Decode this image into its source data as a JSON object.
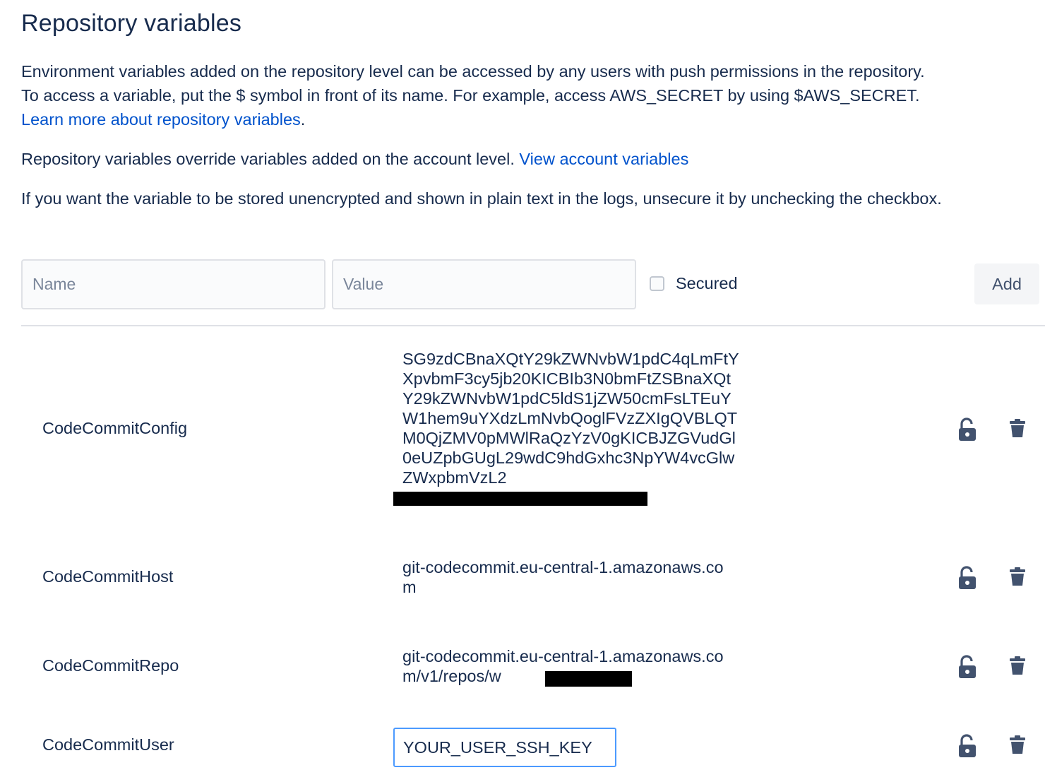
{
  "page": {
    "title": "Repository variables",
    "intro_line1": "Environment variables added on the repository level can be accessed by any users with push permissions in the repository.",
    "intro_line2": "To access a variable, put the $ symbol in front of its name. For example, access AWS_SECRET by using $AWS_SECRET.",
    "learn_more_link": "Learn more about repository variables",
    "override_text": "Repository variables override variables added on the account level. ",
    "view_account_link": "View account variables",
    "unsecure_text": "If you want the variable to be stored unencrypted and shown in plain text in the logs, unsecure it by unchecking the checkbox."
  },
  "form": {
    "name_placeholder": "Name",
    "value_placeholder": "Value",
    "secured_label": "Secured",
    "secured_checked": false,
    "add_label": "Add"
  },
  "variables": [
    {
      "name": "CodeCommitConfig",
      "value": "SG9zdCBnaXQtY29kZWNvbW1pdC4qLmFtYXpvbmF3cy5jb20KICBIb3N0bmFtZSBnaXQtY29kZWNvbW1pdC5ldS1jZW50cmFsLTEuYW1hem9uYXdzLmNvbQoglFVzZXIgQVBLQTM0QjZMV0pMWlRaQzYzV0gKICBJZGVudGl0eUZpbGUgL29wdC9hdGxhc3NpYW4vcGlwZWxpbmVzL2",
      "redacted": true,
      "icons": [
        "unlock-icon",
        "trash-icon"
      ]
    },
    {
      "name": "CodeCommitHost",
      "value": "git-codecommit.eu-central-1.amazonaws.com",
      "icons": [
        "unlock-icon",
        "trash-icon"
      ]
    },
    {
      "name": "CodeCommitRepo",
      "value": "git-codecommit.eu-central-1.amazonaws.com/v1/repos/w",
      "redacted": true,
      "icons": [
        "unlock-icon",
        "trash-icon"
      ]
    },
    {
      "name": "CodeCommitUser",
      "value": "YOUR_USER_SSH_KEY",
      "editing": true,
      "icons": [
        "unlock-icon",
        "trash-icon"
      ]
    }
  ],
  "colors": {
    "text": "#172b4d",
    "link": "#0052cc",
    "icon": "#42526e",
    "focus_border": "#4c9aff",
    "button_bg": "#f4f5f7"
  }
}
